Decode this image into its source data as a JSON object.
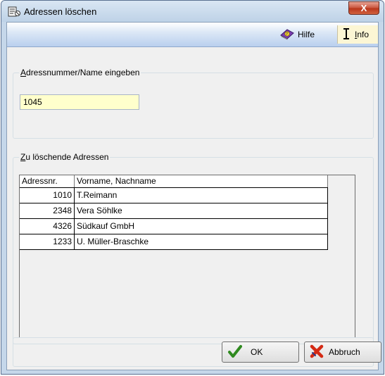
{
  "window": {
    "title": "Adressen löschen",
    "close_label": "X"
  },
  "toolbar": {
    "hilfe_label": "Hilfe",
    "info_label_ul": "I",
    "info_label_rest": "nfo"
  },
  "search": {
    "group_label_ul": "A",
    "group_label_rest": "dressnummer/Name eingeben",
    "value": "1045"
  },
  "delete_list": {
    "group_label_ul": "Z",
    "group_label_rest": "u löschende Adressen",
    "columns": [
      "Adressnr.",
      "Vorname, Nachname"
    ],
    "rows": [
      {
        "nr": "1010",
        "name": "T.Reimann"
      },
      {
        "nr": "2348",
        "name": "Vera Söhlke"
      },
      {
        "nr": "4326",
        "name": "Südkauf GmbH"
      },
      {
        "nr": "1233",
        "name": "U. Müller-Braschke"
      }
    ]
  },
  "buttons": {
    "ok_label": "OK",
    "cancel_label": "Abbruch"
  },
  "colors": {
    "input_background": "#ffffcc",
    "toolbar_gradient_bottom": "#b9cfee",
    "info_highlight": "#fcf6d4"
  },
  "icons": {
    "title": "address-book-delete-icon",
    "hilfe": "help-book-icon",
    "info": "info-cursor-icon",
    "ok": "checkmark-icon",
    "cancel": "red-x-icon"
  }
}
